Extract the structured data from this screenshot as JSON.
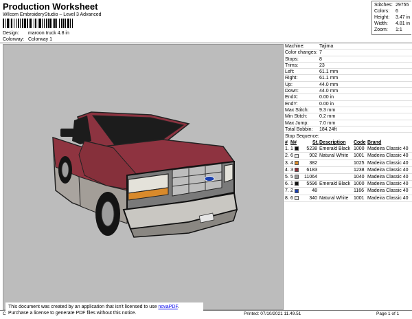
{
  "header": {
    "title": "Production Worksheet",
    "subtitle": "Wilcom EmbroideryStudio – Level 3 Advanced",
    "design_label": "Design:",
    "design_value": "maroon truck 4.8 in",
    "colorway_label": "Colorway:",
    "colorway_value": "Colorway 1"
  },
  "stats": [
    {
      "label": "Stitches:",
      "value": "29755"
    },
    {
      "label": "Colors:",
      "value": "6"
    },
    {
      "label": "Height:",
      "value": "3.47 in"
    },
    {
      "label": "Width:",
      "value": "4.81 in"
    },
    {
      "label": "Zoom:",
      "value": "1:1"
    }
  ],
  "machine_info": [
    {
      "label": "Machine:",
      "value": "Tajima"
    },
    {
      "label": "Color changes:",
      "value": "7"
    },
    {
      "label": "Stops:",
      "value": "8"
    },
    {
      "label": "Trims:",
      "value": "23"
    },
    {
      "label": "Left:",
      "value": "61.1 mm"
    },
    {
      "label": "Right:",
      "value": "61.1 mm"
    },
    {
      "label": "Up:",
      "value": "44.0 mm"
    },
    {
      "label": "Down:",
      "value": "44.0 mm"
    },
    {
      "label": "EndX:",
      "value": "0.00 in"
    },
    {
      "label": "EndY:",
      "value": "0.00 in"
    },
    {
      "label": "Max Stitch:",
      "value": "9.3 mm"
    },
    {
      "label": "Min Stitch:",
      "value": "0.2 mm"
    },
    {
      "label": "Max Jump:",
      "value": "7.0 mm"
    },
    {
      "label": "Total Bobbin:",
      "value": "184.24ft"
    }
  ],
  "stop_sequence": {
    "title": "Stop Sequence:",
    "columns": [
      "#",
      "N#",
      "St.",
      "Description",
      "Code",
      "Brand"
    ],
    "rows": [
      {
        "num": "1.",
        "n": "1",
        "color": "#111111",
        "st": "5238",
        "desc": "Emerald Black",
        "code": "1000",
        "brand": "Madeira Classic 40"
      },
      {
        "num": "2.",
        "n": "6",
        "color": "#e6e6e6",
        "st": "902",
        "desc": "Natural White",
        "code": "1001",
        "brand": "Madeira Classic 40"
      },
      {
        "num": "3.",
        "n": "4",
        "color": "#d98a2b",
        "st": "382",
        "desc": "",
        "code": "1025",
        "brand": "Madeira Classic 40"
      },
      {
        "num": "4.",
        "n": "3",
        "color": "#8e2f3a",
        "st": "6183",
        "desc": "",
        "code": "1238",
        "brand": "Madeira Classic 40"
      },
      {
        "num": "5.",
        "n": "5",
        "color": "#9a9a9a",
        "st": "11064",
        "desc": "",
        "code": "1040",
        "brand": "Madeira Classic 40"
      },
      {
        "num": "6.",
        "n": "1",
        "color": "#111111",
        "st": "5596",
        "desc": "Emerald Black",
        "code": "1000",
        "brand": "Madeira Classic 40"
      },
      {
        "num": "7.",
        "n": "2",
        "color": "#1a3fae",
        "st": "48",
        "desc": "",
        "code": "1166",
        "brand": "Madeira Classic 40"
      },
      {
        "num": "8.",
        "n": "6",
        "color": "#e6e6e6",
        "st": "340",
        "desc": "Natural White",
        "code": "1001",
        "brand": "Madeira Classic 40"
      }
    ]
  },
  "footer": {
    "left": "Cr",
    "printed": "Printed: 07/10/2021 11.49.51",
    "page": "Page 1 of 1"
  },
  "notice": {
    "line1_prefix": "This document was created by an application that isn't licensed to use ",
    "link": "novaPDF",
    "line1_suffix": ".",
    "line2": "Purchase a license to generate PDF files without this notice."
  }
}
